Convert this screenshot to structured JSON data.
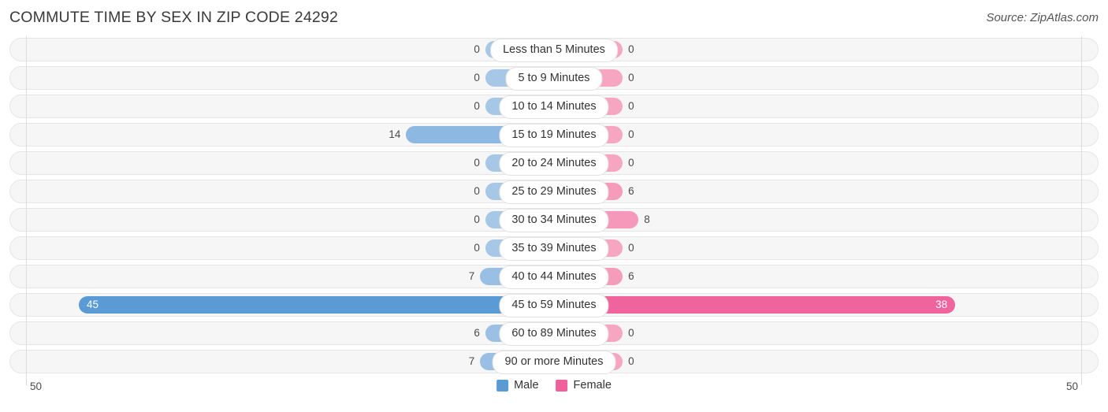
{
  "header": {
    "title": "COMMUTE TIME BY SEX IN ZIP CODE 24292",
    "source": "Source: ZipAtlas.com"
  },
  "axis": {
    "left_end": "50",
    "right_end": "50",
    "max": 50
  },
  "legend": {
    "items": [
      {
        "label": "Male",
        "color": "#5B9BD5"
      },
      {
        "label": "Female",
        "color": "#F0609B"
      }
    ]
  },
  "colors": {
    "male_light": "#A7C7E7",
    "male_strong": "#5B9BD5",
    "female_light": "#F6A6C1",
    "female_strong": "#F0609B",
    "track": "#f6f6f6",
    "track_border": "#e6e6e6"
  },
  "chart_data": {
    "type": "bar",
    "title": "COMMUTE TIME BY SEX IN ZIP CODE 24292",
    "subtitle": "Source: ZipAtlas.com",
    "xlabel": "",
    "ylabel": "",
    "orientation": "horizontal-diverging",
    "xlim": [
      50,
      50
    ],
    "grid": false,
    "legend_position": "bottom-center",
    "categories": [
      "Less than 5 Minutes",
      "5 to 9 Minutes",
      "10 to 14 Minutes",
      "15 to 19 Minutes",
      "20 to 24 Minutes",
      "25 to 29 Minutes",
      "30 to 34 Minutes",
      "35 to 39 Minutes",
      "40 to 44 Minutes",
      "45 to 59 Minutes",
      "60 to 89 Minutes",
      "90 or more Minutes"
    ],
    "series": [
      {
        "name": "Male",
        "side": "left",
        "values": [
          0,
          0,
          0,
          14,
          0,
          0,
          0,
          0,
          7,
          45,
          6,
          7
        ]
      },
      {
        "name": "Female",
        "side": "right",
        "values": [
          0,
          0,
          0,
          0,
          0,
          6,
          8,
          0,
          6,
          38,
          0,
          0
        ]
      }
    ]
  },
  "rows": [
    {
      "label": "Less than 5 Minutes",
      "male": "0",
      "female": "0"
    },
    {
      "label": "5 to 9 Minutes",
      "male": "0",
      "female": "0"
    },
    {
      "label": "10 to 14 Minutes",
      "male": "0",
      "female": "0"
    },
    {
      "label": "15 to 19 Minutes",
      "male": "14",
      "female": "0"
    },
    {
      "label": "20 to 24 Minutes",
      "male": "0",
      "female": "0"
    },
    {
      "label": "25 to 29 Minutes",
      "male": "0",
      "female": "6"
    },
    {
      "label": "30 to 34 Minutes",
      "male": "0",
      "female": "8"
    },
    {
      "label": "35 to 39 Minutes",
      "male": "0",
      "female": "0"
    },
    {
      "label": "40 to 44 Minutes",
      "male": "7",
      "female": "6"
    },
    {
      "label": "45 to 59 Minutes",
      "male": "45",
      "female": "38"
    },
    {
      "label": "60 to 89 Minutes",
      "male": "6",
      "female": "0"
    },
    {
      "label": "90 or more Minutes",
      "male": "7",
      "female": "0"
    }
  ]
}
